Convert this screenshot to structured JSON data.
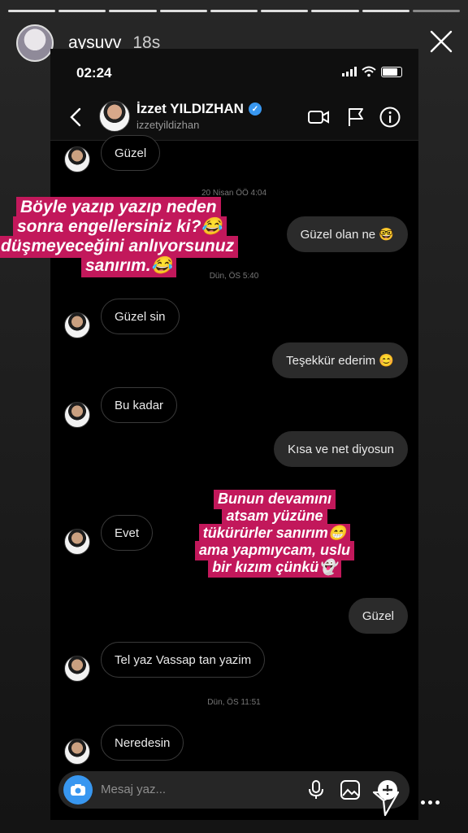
{
  "story": {
    "username": "aysuvv",
    "age": "18s"
  },
  "phone": {
    "clock": "02:24",
    "contact_name": "İzzet YILDIZHAN",
    "contact_handle": "izzetyildizhan"
  },
  "messages": [
    {
      "dir": "in",
      "text": "Güzel"
    },
    {
      "dir": "out",
      "text": "Güzel olan ne 🤓"
    },
    {
      "dir": "in",
      "text": "Güzel sin"
    },
    {
      "dir": "out",
      "text": "Teşekkür ederim 😊"
    },
    {
      "dir": "in",
      "text": "Bu kadar"
    },
    {
      "dir": "out",
      "text": "Kısa ve net diyosun"
    },
    {
      "dir": "in",
      "text": "Evet"
    },
    {
      "dir": "out",
      "text": "Güzel"
    },
    {
      "dir": "in",
      "text": "Tel yaz Vassap tan yazim"
    },
    {
      "dir": "in",
      "text": "Neredesin"
    }
  ],
  "timestamps": [
    "20 Nisan ÖÖ 4:04",
    "Dün, ÖS 5:40",
    "Dün, ÖS 11:51"
  ],
  "composer": {
    "placeholder": "Mesaj yaz..."
  },
  "overlay_top": [
    "Böyle yazıp yazıp neden",
    "sonra engellersiniz ki?😂",
    "düşmeyeceğini anlıyorsunuz",
    "sanırım.😂"
  ],
  "overlay_mid": [
    "Bunun devamını",
    "atsam yüzüne",
    "tükürürler sanırım😁",
    "ama yapmıycam, uslu",
    "bir kızım çünkü👻"
  ],
  "colors": {
    "highlight": "#c2185b",
    "verified": "#3897f0"
  },
  "icons": [
    "close-icon",
    "back-icon",
    "video-call-icon",
    "flag-icon",
    "info-icon",
    "camera-icon",
    "microphone-icon",
    "gallery-icon",
    "plus-icon",
    "send-icon",
    "more-icon"
  ]
}
